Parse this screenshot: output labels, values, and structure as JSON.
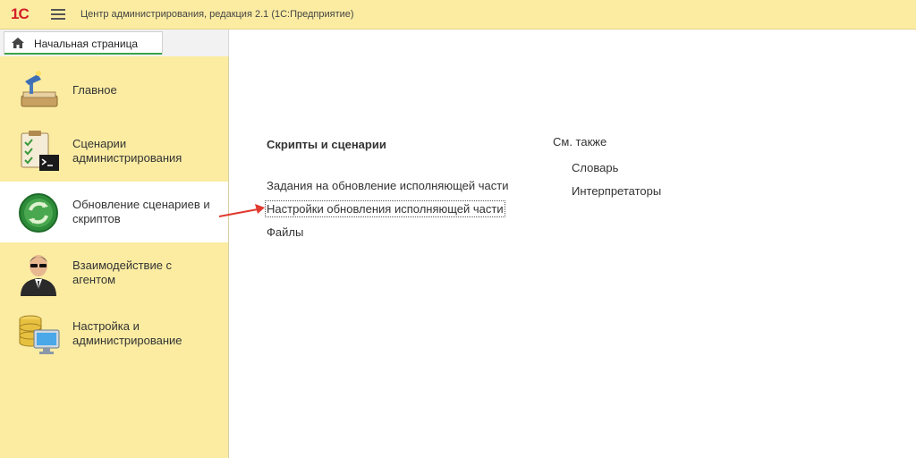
{
  "window": {
    "logo_text": "1С",
    "title": "Центр администрирования, редакция 2.1  (1С:Предприятие)"
  },
  "tabs": {
    "home_label": "Начальная страница"
  },
  "sidebar": {
    "items": [
      {
        "label": "Главное",
        "icon": "desk-lamp-icon",
        "active": false
      },
      {
        "label": "Сценарии\nадминистрирования",
        "icon": "checklist-terminal-icon",
        "active": false
      },
      {
        "label": "Обновление сценариев и\nскриптов",
        "icon": "refresh-globe-icon",
        "active": true
      },
      {
        "label": "Взаимодействие с\nагентом",
        "icon": "agent-icon",
        "active": false
      },
      {
        "label": "Настройка и\nадминистрирование",
        "icon": "database-monitor-icon",
        "active": false
      }
    ]
  },
  "main": {
    "section_title": "Скрипты и сценарии",
    "links": [
      "Задания на обновление исполняющей части",
      "Настройки обновления исполняющей части",
      "Файлы"
    ],
    "see_also": {
      "title": "См. также",
      "links": [
        "Словарь",
        "Интерпретаторы"
      ]
    }
  },
  "colors": {
    "header_bg": "#fbeca2",
    "sidebar_bg": "#fbeca2",
    "active_item_bg": "#ffffff",
    "logo_red": "#d4202a",
    "tab_underline": "#3aa34a",
    "annotation_arrow": "#e03a2f"
  }
}
